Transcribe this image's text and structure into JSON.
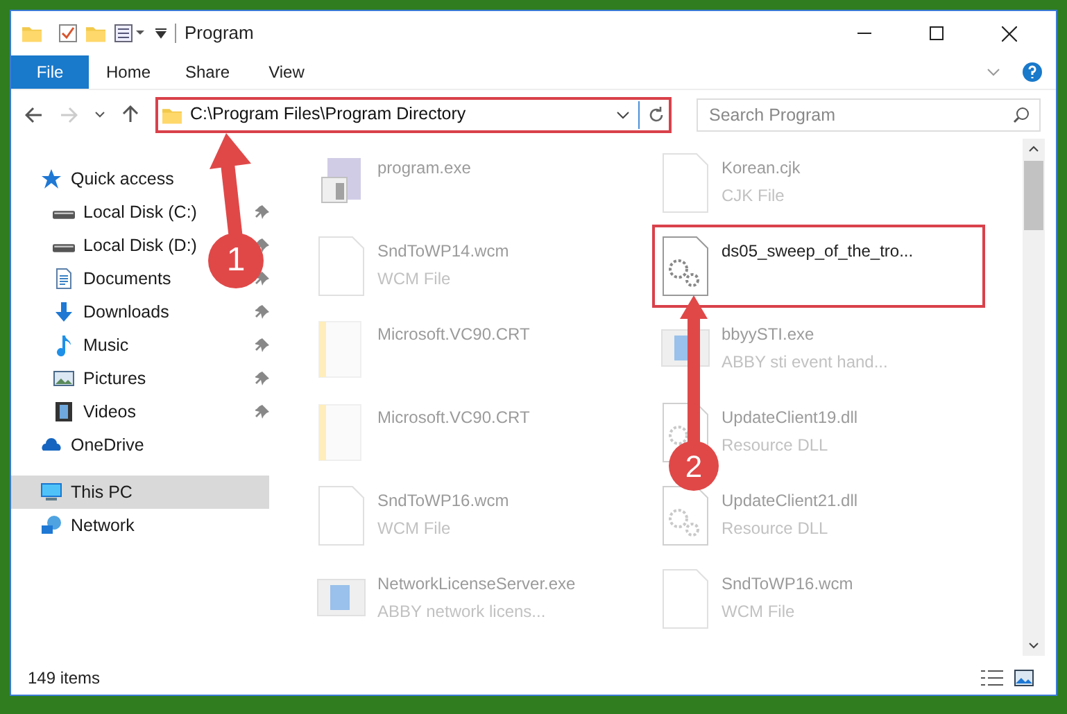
{
  "window": {
    "title": "Program"
  },
  "ribbon_tabs": [
    {
      "label": "File",
      "selected": true
    },
    {
      "label": "Home",
      "selected": false
    },
    {
      "label": "Share",
      "selected": false
    },
    {
      "label": "View",
      "selected": false
    }
  ],
  "address_bar": {
    "path": "C:\\Program Files\\Program Directory",
    "highlighted": true
  },
  "search": {
    "placeholder": "Search Program"
  },
  "sidebar": {
    "items": [
      {
        "label": "Quick access",
        "kind": "star",
        "selected": false,
        "children": [
          {
            "label": "Local Disk (C:)",
            "kind": "disk",
            "pinned": true,
            "selected": false
          },
          {
            "label": "Local Disk (D:)",
            "kind": "disk",
            "pinned": true,
            "selected": false
          },
          {
            "label": "Documents",
            "kind": "document",
            "pinned": true,
            "selected": false
          },
          {
            "label": "Downloads",
            "kind": "download",
            "pinned": true,
            "selected": false
          },
          {
            "label": "Music",
            "kind": "music",
            "pinned": true,
            "selected": false
          },
          {
            "label": "Pictures",
            "kind": "pictures",
            "pinned": true,
            "selected": false
          },
          {
            "label": "Videos",
            "kind": "video",
            "pinned": true,
            "selected": false
          }
        ]
      },
      {
        "label": "OneDrive",
        "kind": "cloud",
        "selected": false
      },
      {
        "label": "This PC",
        "kind": "pc",
        "selected": true
      },
      {
        "label": "Network",
        "kind": "network",
        "selected": false
      }
    ]
  },
  "files": [
    {
      "name": "program.exe",
      "kind": "app",
      "dimmed": true,
      "highlighted": false
    },
    {
      "name": "Korean.cjk",
      "type": "CJK File",
      "kind": "blank",
      "dimmed": true,
      "highlighted": false
    },
    {
      "name": "SndToWP14.wcm",
      "type": "WCM File",
      "kind": "blank",
      "dimmed": true,
      "highlighted": false
    },
    {
      "name": "ds05_sweep_of_the_tro...",
      "kind": "gears",
      "dimmed": false,
      "highlighted": true
    },
    {
      "name": "Microsoft.VC90.CRT",
      "kind": "folder",
      "dimmed": true,
      "highlighted": false
    },
    {
      "name": "bbyySTI.exe",
      "type": "ABBY sti event hand...",
      "kind": "window",
      "dimmed": true,
      "highlighted": false
    },
    {
      "name": "Microsoft.VC90.CRT",
      "kind": "folder",
      "dimmed": true,
      "highlighted": false
    },
    {
      "name": "UpdateClient19.dll",
      "type": "Resource DLL",
      "kind": "gears",
      "dimmed": true,
      "highlighted": false
    },
    {
      "name": "SndToWP16.wcm",
      "type": "WCM File",
      "kind": "blank",
      "dimmed": true,
      "highlighted": false
    },
    {
      "name": "UpdateClient21.dll",
      "type": "Resource DLL",
      "kind": "gears",
      "dimmed": true,
      "highlighted": false
    },
    {
      "name": "NetworkLicenseServer.exe",
      "type": "ABBY network licens...",
      "kind": "window",
      "dimmed": true,
      "highlighted": false
    },
    {
      "name": "SndToWP16.wcm",
      "type": "WCM File",
      "kind": "blank",
      "dimmed": true,
      "highlighted": false
    }
  ],
  "status_bar": {
    "count": "149 items"
  },
  "annotations": [
    {
      "number": "1"
    },
    {
      "number": "2"
    }
  ]
}
